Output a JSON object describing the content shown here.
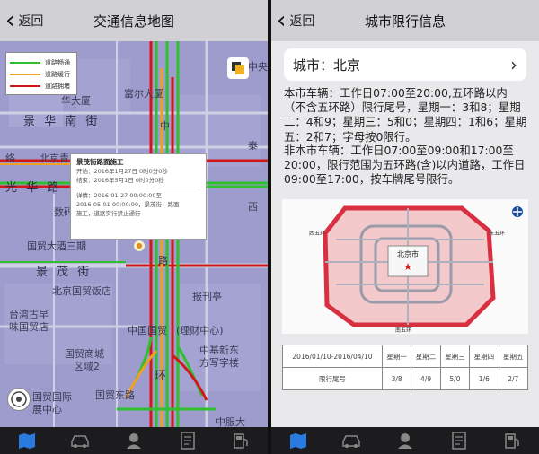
{
  "left": {
    "back_label": "返回",
    "title": "交通信息地图",
    "legend": [
      {
        "label": "道路畅通",
        "color": "#2fbf2f"
      },
      {
        "label": "道路缓行",
        "color": "#f0a020"
      },
      {
        "label": "道路拥堵",
        "color": "#d01818"
      }
    ],
    "map_labels": {
      "l1": "中央",
      "l2": "富尔大厦",
      "l3": "华大厦",
      "l4": "景 华 南 街",
      "l5": "北京青",
      "l6": "络",
      "l7": "光 华 路",
      "l8": "数码",
      "l9": "国贸大酒三期",
      "l10": "景 茂 街",
      "l11": "北京国贸饭店",
      "l12": "台湾古早",
      "l13": "味国贸店",
      "l14": "国贸商城",
      "l15": "区域2",
      "l16": "国贸国际",
      "l17": "展中心",
      "l18": "国贸东路",
      "l19": "中国国贸",
      "l20": "(理财中心)",
      "l21": "中基新东",
      "l22": "方写字楼",
      "l23": "中服大",
      "l24": "报刊亭",
      "l25": "中",
      "l26": "环",
      "l27": "路",
      "l28": "泰",
      "l29": "西"
    },
    "popup": {
      "title": "景茂街路面施工",
      "start": "开始：2016年1月27日 0时0分0秒",
      "end": "结束：2016年5月1日 0时0分0秒",
      "detail_1": "详情：2016-01-27 00:00:00至",
      "detail_2": "2016-05-01 00:00:00，景茂街，路面",
      "detail_3": "施工，道路实行禁止通行"
    }
  },
  "right": {
    "back_label": "返回",
    "title": "城市限行信息",
    "city_label": "城市：北京",
    "local_text": "本市车辆：工作日07:00至20:00,五环路以内（不含五环路）限行尾号，星期一：3和8；星期二：4和9；星期三：5和0；星期四：1和6；星期五：2和7；字母按0限行。",
    "nonlocal_text": "非本市车辆：工作日07:00至09:00和17:00至20:00，限行范围为五环路(含)以内道路，工作日09:00至17:00，按车牌尾号限行。",
    "map_labels": {
      "center": "北京市",
      "west": "西五环",
      "east": "东五环",
      "south": "南五环"
    },
    "table": {
      "header": [
        "2016/01/10-2016/04/10",
        "星期一",
        "星期二",
        "星期三",
        "星期四",
        "星期五"
      ],
      "row": [
        "限行尾号",
        "3/8",
        "4/9",
        "5/0",
        "1/6",
        "2/7"
      ]
    }
  }
}
